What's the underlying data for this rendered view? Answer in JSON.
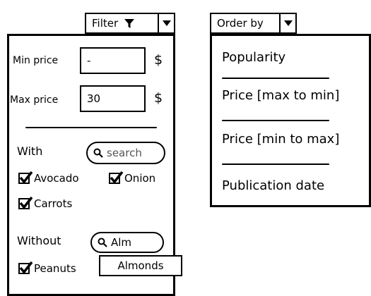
{
  "filter": {
    "button_label": "Filter",
    "min_price": {
      "label": "Min price",
      "value": "-",
      "currency": "$"
    },
    "max_price": {
      "label": "Max price",
      "value": "30",
      "currency": "$"
    },
    "with": {
      "label": "With",
      "search_placeholder": "search",
      "items": [
        {
          "label": "Avocado",
          "checked": true
        },
        {
          "label": "Onion",
          "checked": true
        },
        {
          "label": "Carrots",
          "checked": true
        }
      ]
    },
    "without": {
      "label": "Without",
      "search_value": "Alm",
      "suggestion": "Almonds",
      "items": [
        {
          "label": "Peanuts",
          "checked": true
        }
      ]
    }
  },
  "order": {
    "button_label": "Order by",
    "options": [
      "Popularity",
      "Price [max to min]",
      "Price [min to max]",
      "Publication date"
    ]
  },
  "icons": {
    "filter": "funnel-icon",
    "dropdown": "triangle-down-icon",
    "search": "magnifier-icon",
    "check": "checkmark-icon"
  }
}
